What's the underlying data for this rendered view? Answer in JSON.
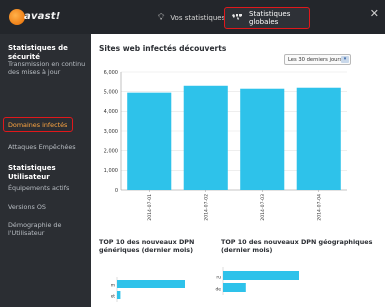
{
  "app": {
    "logo_text": "avast!",
    "close_glyph": "✕"
  },
  "tabs": [
    {
      "label": "Vos statistiques",
      "icon": "lightbulb-icon"
    },
    {
      "label": "Statistiques globales",
      "icon": "world-map-icon",
      "active": true
    }
  ],
  "sidebar": {
    "section1_title": "Statistiques de sécurité",
    "items1": [
      {
        "label": "Transmission en continu des mises à jour"
      },
      {
        "label": "Domaines infectés",
        "active": true
      },
      {
        "label": "Attaques Empêchées"
      }
    ],
    "section2_title": "Statistiques Utilisateur",
    "items2": [
      {
        "label": "Équipements actifs"
      },
      {
        "label": "Versions OS"
      },
      {
        "label": "Démographie de l'Utilisateur"
      }
    ]
  },
  "main": {
    "title": "Sites web infectés découverts",
    "period_select": "Les 30 derniers jours",
    "generic_title": "TOP 10 des nouveaux DPN génériques (dernier mois)",
    "geo_title": "TOP 10 des nouveaux DPN géographiques (dernier mois)"
  },
  "chart_data": [
    {
      "type": "bar",
      "title": "Sites web infectés découverts",
      "categories": [
        "2014-07-01",
        "2014-07-02",
        "2014-07-03",
        "2014-07-04"
      ],
      "values": [
        4950,
        5300,
        5150,
        5200
      ],
      "ylim": [
        0,
        6000
      ],
      "yticks": [
        "0",
        "1,000",
        "2,000",
        "3,000",
        "4,000",
        "5,000",
        "6,000"
      ],
      "grid": true,
      "color": "#2ec2ea"
    },
    {
      "type": "bar",
      "orientation": "horizontal",
      "title": "TOP 10 des nouveaux DPN génériques (dernier mois)",
      "categories": [
        "com",
        "net"
      ],
      "values": [
        100,
        5
      ],
      "color": "#2ec2ea"
    },
    {
      "type": "bar",
      "orientation": "horizontal",
      "title": "TOP 10 des nouveaux DPN géographiques (dernier mois)",
      "categories": [
        "ru",
        "de"
      ],
      "values": [
        100,
        30
      ],
      "color": "#2ec2ea"
    }
  ]
}
